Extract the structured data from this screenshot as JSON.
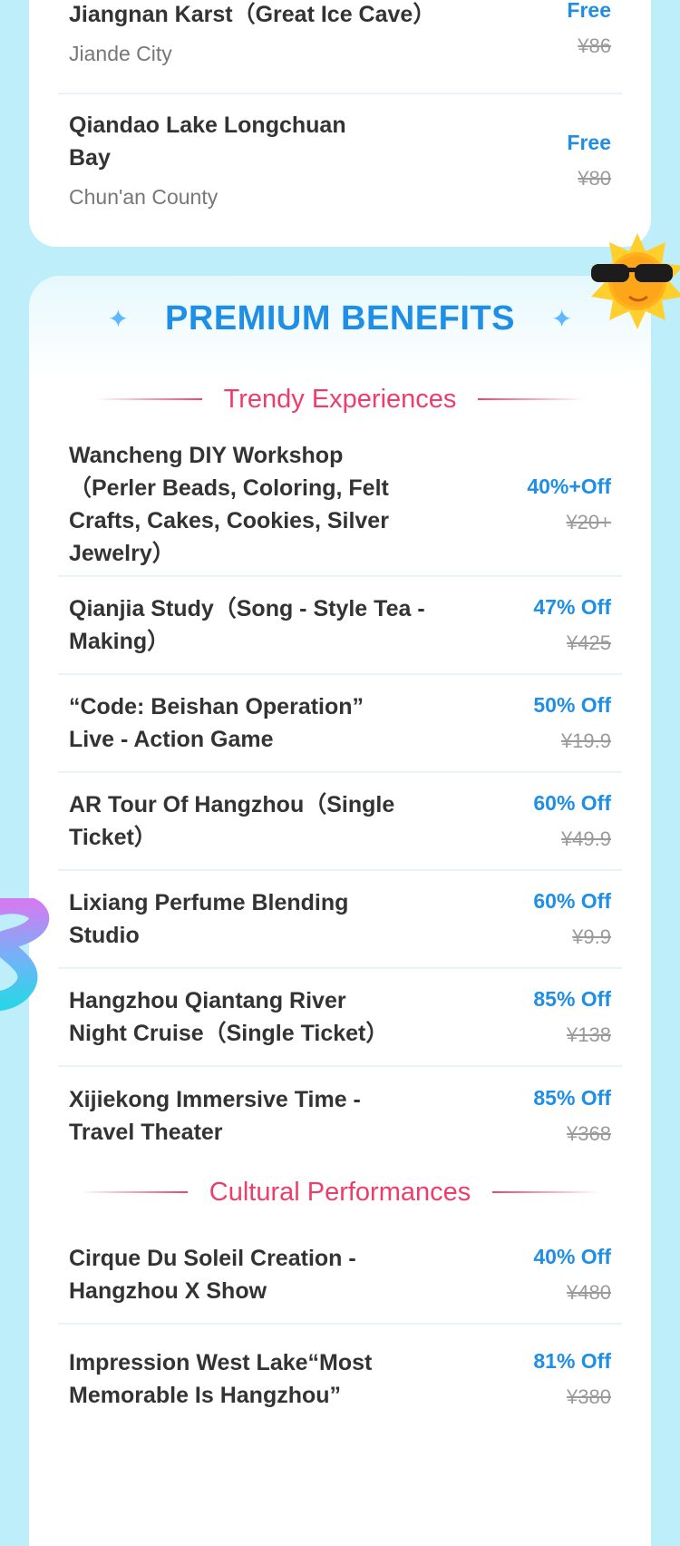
{
  "top_items": [
    {
      "name": "Jiangnan Karst（Great Ice Cave）",
      "location": "Jiande City",
      "deal": "Free",
      "original": "¥86"
    },
    {
      "name": "Qiandao Lake Longchuan Bay",
      "location": "Chun'an County",
      "deal": "Free",
      "original": "¥80"
    }
  ],
  "premium": {
    "title": "PREMIUM BENEFITS",
    "sections": [
      {
        "title": "Trendy Experiences",
        "items": [
          {
            "name": "Wancheng DIY Workshop （Perler Beads, Coloring, Felt Crafts, Cakes, Cookies, Silver Jewelry）",
            "deal": "40%+Off",
            "original": "¥20+"
          },
          {
            "name": "Qianjia Study（Song - Style Tea - Making）",
            "deal": "47% Off",
            "original": "¥425"
          },
          {
            "name": "“Code: Beishan Operation” Live - Action Game",
            "deal": "50% Off",
            "original": "¥19.9"
          },
          {
            "name": "AR Tour Of Hangzhou（Single Ticket）",
            "deal": "60% Off",
            "original": "¥49.9"
          },
          {
            "name": "Lixiang Perfume Blending Studio",
            "deal": "60% Off",
            "original": "¥9.9"
          },
          {
            "name": "Hangzhou Qiantang River Night Cruise（Single Ticket）",
            "deal": "85% Off",
            "original": "¥138"
          },
          {
            "name": "Xijiekong Immersive Time - Travel Theater",
            "deal": "85% Off",
            "original": "¥368"
          }
        ]
      },
      {
        "title": "Cultural Performances",
        "items": [
          {
            "name": "Cirque Du Soleil Creation - Hangzhou X Show",
            "deal": "40% Off",
            "original": "¥480"
          },
          {
            "name": "Impression West Lake“Most Memorable Is Hangzhou”",
            "deal": "81% Off",
            "original": "¥380"
          }
        ]
      }
    ]
  },
  "icons": {
    "sparkle": "✦",
    "sun": "sun-with-sunglasses-icon",
    "ribbon": "ribbon-decoration-icon"
  },
  "colors": {
    "accent_blue": "#1f8fe6",
    "accent_pink": "#ee3d6b",
    "background": "#bdeefa"
  }
}
